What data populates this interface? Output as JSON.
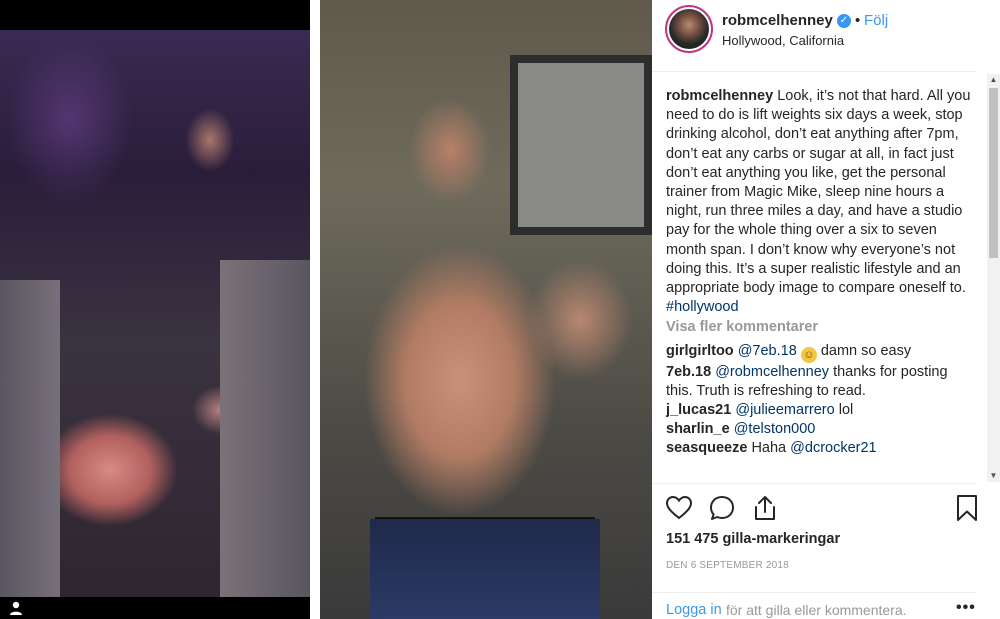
{
  "post": {
    "username": "robmcelhenney",
    "verified_icon": "verified-check-icon",
    "dot": "•",
    "follow_label": "Följ",
    "location": "Hollywood, California",
    "caption_user": "robmcelhenney",
    "caption_text": "Look, it’s not that hard. All you need to do is lift weights six days a week, stop drinking alcohol, don’t eat anything after 7pm, don’t eat any carbs or sugar at all, in fact just don’t eat anything you like, get the personal trainer from Magic Mike, sleep nine hours a night, run three miles a day, and have a studio pay for the whole thing over a six to seven month span. I don’t know why everyone’s not doing this. It’s a super realistic lifestyle and an appropriate body image to compare oneself to.",
    "caption_hashtag": "#hollywood",
    "more_comments_label": "Visa fler kommentarer",
    "comments": [
      {
        "user": "girlgirltoo",
        "mention": "@7eb.18",
        "text": "damn so easy",
        "emoji": "😂"
      },
      {
        "user": "7eb.18",
        "mention": "@robmcelhenney",
        "text": "thanks for posting this. Truth is refreshing to read."
      },
      {
        "user": "j_lucas21",
        "mention": "@julieemarrero",
        "text": "lol"
      },
      {
        "user": "sharlin_e",
        "mention": "@telston000",
        "text": ""
      },
      {
        "user": "seasqueeze",
        "mention": "@dcrocker21",
        "text": "Haha"
      }
    ],
    "likes_text": "151 475 gilla-markeringar",
    "date": "DEN 6 SEPTEMBER 2018",
    "login_link": "Logga in",
    "login_text": "för att gilla eller kommentera.",
    "more_dots": "•••"
  },
  "icons": {
    "like": "heart-icon",
    "comment": "comment-bubble-icon",
    "share": "share-upload-icon",
    "save": "bookmark-icon",
    "user_tag": "user-tag-icon"
  },
  "colors": {
    "link_blue": "#3897f0",
    "hashtag": "#003569",
    "muted": "#999999",
    "text": "#262626"
  }
}
